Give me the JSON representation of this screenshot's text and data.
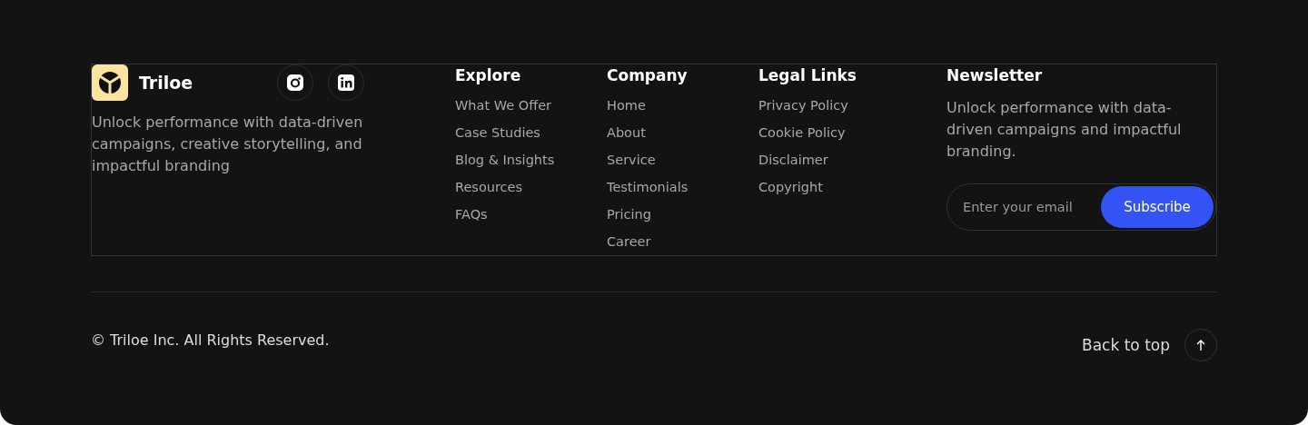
{
  "brand": {
    "name": "Triloe",
    "description": "Unlock performance with data-driven campaigns, creative storytelling, and impactful branding"
  },
  "link_columns": [
    {
      "heading": "Explore",
      "links": [
        "What We Offer",
        "Case Studies",
        "Blog & Insights",
        "Resources",
        "FAQs"
      ]
    },
    {
      "heading": "Company",
      "links": [
        "Home",
        "About",
        "Service",
        "Testimonials",
        "Pricing",
        "Career"
      ]
    },
    {
      "heading": "Legal Links",
      "links": [
        "Privacy Policy",
        "Cookie Policy",
        "Disclaimer",
        "Copyright"
      ]
    }
  ],
  "newsletter": {
    "heading": "Newsletter",
    "description": "Unlock performance with data-driven campaigns and impactful branding.",
    "email": {
      "placeholder": "Enter your email"
    },
    "button": "Subscribe"
  },
  "copyright": "© Triloe Inc. All Rights Reserved.",
  "back_to_top": "Back to top"
}
